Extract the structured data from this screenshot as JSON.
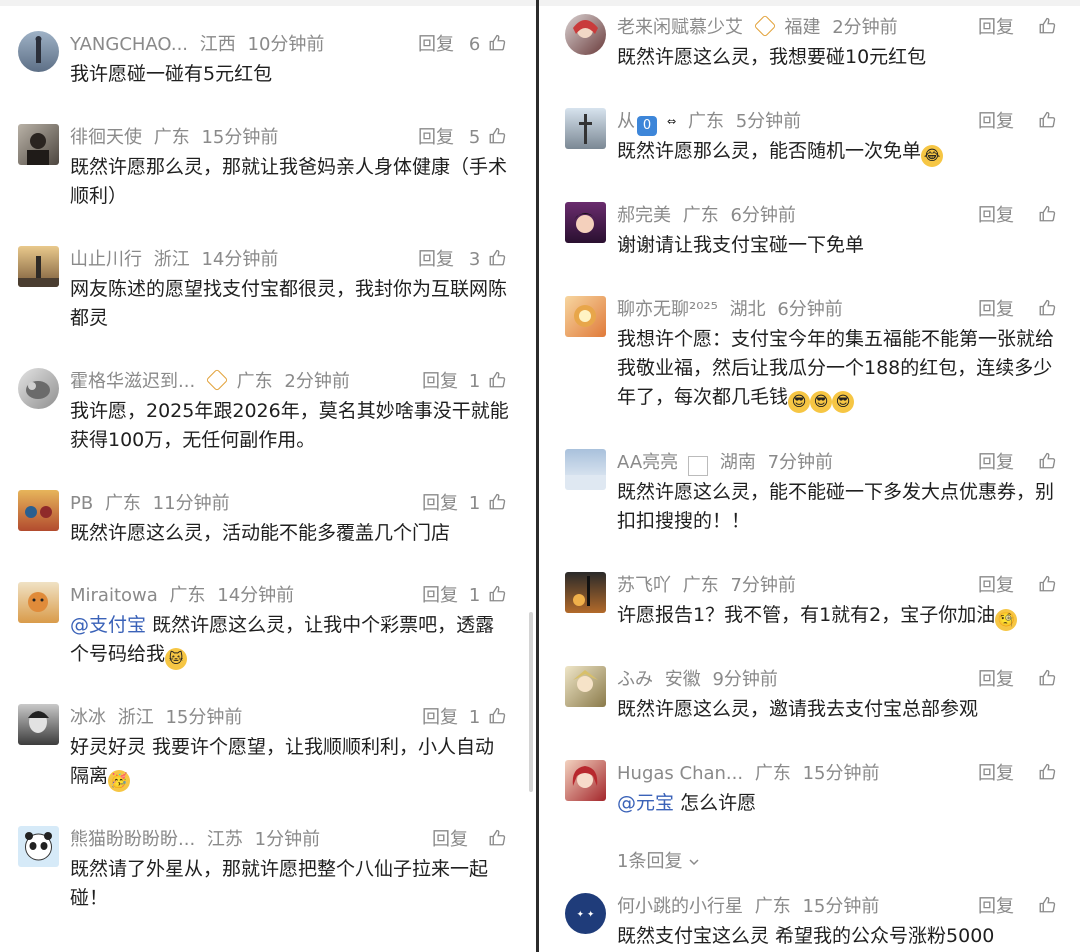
{
  "left": {
    "comments": [
      {
        "user": "YANGCHAO...",
        "region": "江西",
        "time": "10分钟前",
        "reply": "回复",
        "likes": "6",
        "text": "我许愿碰一碰有5元红包"
      },
      {
        "user": "徘徊天使",
        "region": "广东",
        "time": "15分钟前",
        "reply": "回复",
        "likes": "5",
        "text": "既然许愿那么灵，那就让我爸妈亲人身体健康（手术顺利）"
      },
      {
        "user": "山止川行",
        "region": "浙江",
        "time": "14分钟前",
        "reply": "回复",
        "likes": "3",
        "text": "网友陈述的愿望找支付宝都很灵，我封你为互联网陈都灵"
      },
      {
        "user": "霍格华滋迟到...",
        "region": "广东",
        "time": "2分钟前",
        "reply": "回复",
        "likes": "1",
        "text": "我许愿，2025年跟2026年，莫名其妙啥事没干就能获得100万，无任何副作用。"
      },
      {
        "user": "PB",
        "region": "广东",
        "time": "11分钟前",
        "reply": "回复",
        "likes": "1",
        "text": "既然许愿这么灵，活动能不能多覆盖几个门店"
      },
      {
        "user": "Miraitowa",
        "region": "广东",
        "time": "14分钟前",
        "reply": "回复",
        "likes": "1",
        "mention": "@支付宝",
        "text": "既然许愿这么灵，让我中个彩票吧，透露个号码给我"
      },
      {
        "user": "冰冰",
        "region": "浙江",
        "time": "15分钟前",
        "reply": "回复",
        "likes": "1",
        "text": "好灵好灵 我要许个愿望，让我顺顺利利，小人自动隔离"
      },
      {
        "user": "熊猫盼盼盼盼...",
        "region": "江苏",
        "time": "1分钟前",
        "reply": "回复",
        "likes": "",
        "text": "既然请了外星从，那就许愿把整个八仙子拉来一起碰！"
      }
    ]
  },
  "right": {
    "comments": [
      {
        "user": "老来闲赋慕少艾",
        "region": "福建",
        "time": "2分钟前",
        "reply": "回复",
        "likes": "",
        "text": "既然许愿这么灵，我想要碰10元红包"
      },
      {
        "user": "从",
        "region": "广东",
        "time": "5分钟前",
        "reply": "回复",
        "likes": "",
        "keycap": "0",
        "text": "既然许愿那么灵，能否随机一次免单"
      },
      {
        "user": "郝完美",
        "region": "广东",
        "time": "6分钟前",
        "reply": "回复",
        "likes": "",
        "text": "谢谢请让我支付宝碰一下免单"
      },
      {
        "user": "聊亦无聊²⁰²⁵",
        "region": "湖北",
        "time": "6分钟前",
        "reply": "回复",
        "likes": "",
        "text": "我想许个愿：支付宝今年的集五福能不能第一张就给我敬业福，然后让我瓜分一个188的红包，连续多少年了，每次都几毛钱"
      },
      {
        "user": "AA亮亮",
        "region": "湖南",
        "time": "7分钟前",
        "reply": "回复",
        "likes": "",
        "text": "既然许愿这么灵，能不能碰一下多发大点优惠券，别扣扣搜搜的！！"
      },
      {
        "user": "苏飞吖",
        "region": "广东",
        "time": "7分钟前",
        "reply": "回复",
        "likes": "",
        "text": "许愿报告1？我不管，有1就有2，宝子你加油"
      },
      {
        "user": "ふみ",
        "region": "安徽",
        "time": "9分钟前",
        "reply": "回复",
        "likes": "",
        "text": "既然许愿这么灵，邀请我去支付宝总部参观"
      },
      {
        "user": "Hugas Chan...",
        "region": "广东",
        "time": "15分钟前",
        "reply": "回复",
        "likes": "",
        "mention": "@元宝",
        "text": "怎么许愿",
        "sub": "1条回复"
      },
      {
        "user": "何小跳的小行星",
        "region": "广东",
        "time": "15分钟前",
        "reply": "回复",
        "likes": "",
        "text": "既然支付宝这么灵 希望我的公众号涨粉5000"
      }
    ]
  },
  "colors": {
    "meta": "#8a8a8a",
    "mention": "#3a62b8",
    "divider": "#2b2b2b"
  },
  "icons": {
    "like": "thumbs-up-icon",
    "expand": "chevron-down-icon",
    "badge": "gold-badge-icon"
  }
}
